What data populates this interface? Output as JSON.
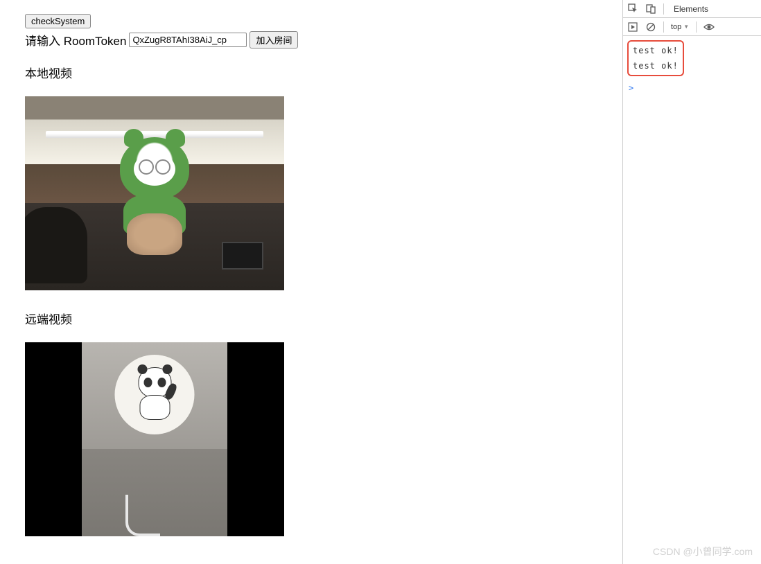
{
  "controls": {
    "check_system_label": "checkSystem",
    "token_prompt": "请输入 RoomToken",
    "token_value": "QxZugR8TAhI38AiJ_cp",
    "join_label": "加入房间"
  },
  "sections": {
    "local_video_title": "本地视频",
    "remote_video_title": "远端视频"
  },
  "devtools": {
    "tabs": {
      "elements": "Elements"
    },
    "console_toolbar": {
      "context": "top",
      "dropdown_marker": "▼"
    },
    "console_lines": [
      "test ok!",
      "test ok!"
    ],
    "prompt": ">"
  },
  "watermark": "CSDN @小曾同学.com"
}
